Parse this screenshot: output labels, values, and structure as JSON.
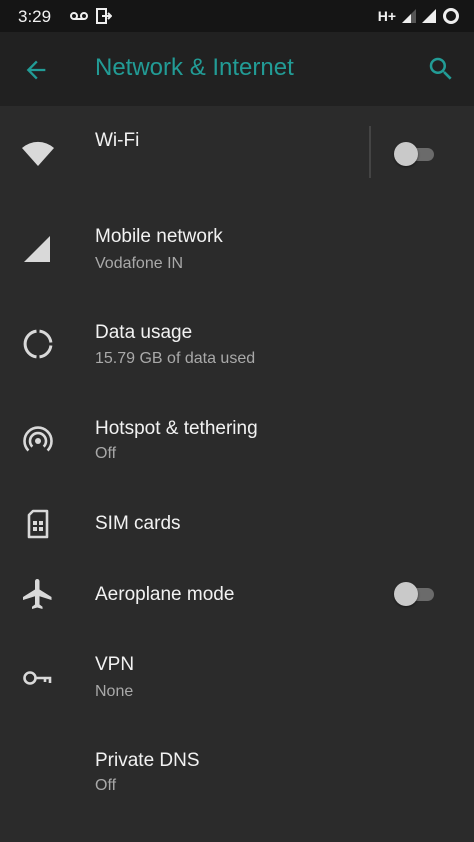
{
  "status_bar": {
    "time": "3:29",
    "network_type": "H+",
    "icons": [
      "voicemail-icon",
      "exit-icon",
      "signal-icon",
      "signal-icon",
      "battery-ring-icon"
    ]
  },
  "app_bar": {
    "title": "Network & Internet",
    "back_icon": "arrow-back-icon",
    "search_icon": "search-icon",
    "accent_color": "#229c96"
  },
  "items": [
    {
      "title": "Wi-Fi",
      "subtitle": "",
      "icon": "wifi-icon",
      "toggle": "off"
    },
    {
      "title": "Mobile network",
      "subtitle": "Vodafone IN",
      "icon": "cellular-signal-icon"
    },
    {
      "title": "Data usage",
      "subtitle": "15.79 GB of data used",
      "icon": "data-usage-icon"
    },
    {
      "title": "Hotspot & tethering",
      "subtitle": "Off",
      "icon": "hotspot-icon"
    },
    {
      "title": "SIM cards",
      "subtitle": "",
      "icon": "sim-card-icon"
    },
    {
      "title": "Aeroplane mode",
      "subtitle": "",
      "icon": "airplane-icon",
      "toggle": "off"
    },
    {
      "title": "VPN",
      "subtitle": "None",
      "icon": "vpn-key-icon"
    },
    {
      "title": "Private DNS",
      "subtitle": "Off",
      "icon": ""
    }
  ]
}
